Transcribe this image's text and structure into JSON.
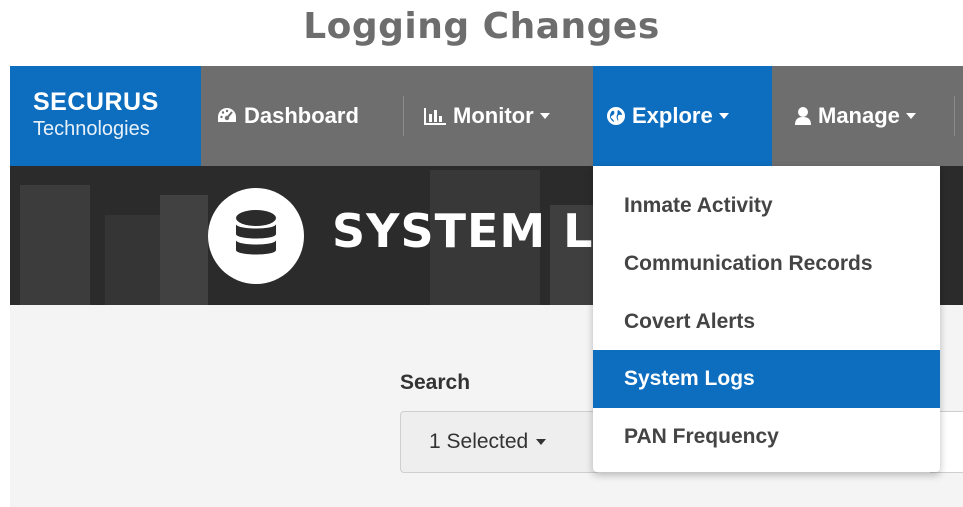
{
  "slide_title": "Logging Changes",
  "logo": {
    "brand": "SECURUS",
    "sub": "Technologies"
  },
  "nav": {
    "dashboard": "Dashboard",
    "monitor": "Monitor",
    "explore": "Explore",
    "manage": "Manage"
  },
  "banner": {
    "title": "SYSTEM LOGS"
  },
  "explore_menu": {
    "items": [
      {
        "label": "Inmate Activity"
      },
      {
        "label": "Communication Records"
      },
      {
        "label": "Covert Alerts"
      },
      {
        "label": "System Logs",
        "active": true
      },
      {
        "label": "PAN Frequency"
      }
    ]
  },
  "search": {
    "label": "Search",
    "select_value": "1 Selected"
  },
  "colors": {
    "brand_blue": "#0d6ebf",
    "nav_gray": "#6e6e6e",
    "title_gray": "#6d6d6d"
  }
}
